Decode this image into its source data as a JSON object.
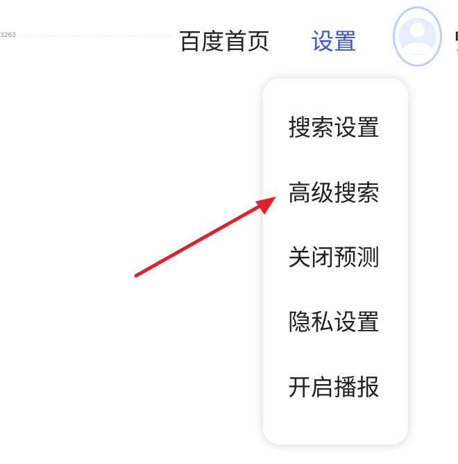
{
  "corner_label": "3263",
  "nav": {
    "home_label": "百度首页",
    "settings_label": "设置",
    "cut_label": "맞"
  },
  "colors": {
    "settings_link": "#3b56d9",
    "avatar_ring": "#bcd1fa",
    "arrow": "#e0202a"
  },
  "settings_menu": {
    "items": [
      {
        "label": "搜索设置"
      },
      {
        "label": "高级搜索"
      },
      {
        "label": "关闭预测"
      },
      {
        "label": "隐私设置"
      },
      {
        "label": "开启播报"
      }
    ]
  },
  "icons": {
    "avatar": "default-user-avatar-icon",
    "annotation": "red-arrow-pointer-icon"
  }
}
